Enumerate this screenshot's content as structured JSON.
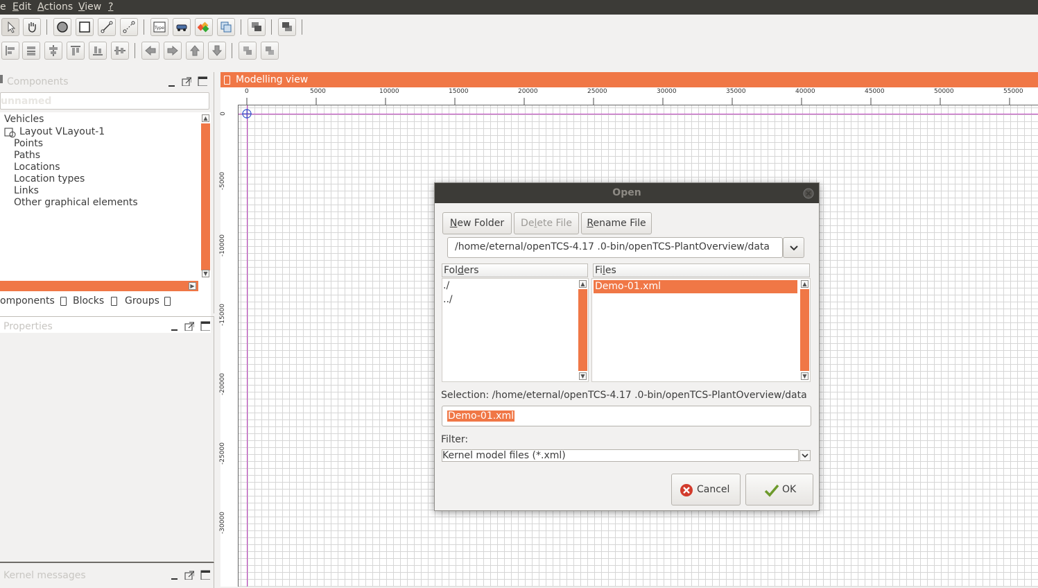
{
  "menubar": {
    "items": [
      "e",
      "Edit",
      "Actions",
      "View",
      "?"
    ]
  },
  "components_panel": {
    "title": "Components",
    "model_name": "unnamed",
    "tree": {
      "vehicles": "Vehicles",
      "layout": "Layout VLayout-1",
      "children": [
        "Points",
        "Paths",
        "Locations",
        "Location types",
        "Links",
        "Other graphical elements"
      ]
    },
    "tabs": [
      "omponents",
      "Blocks",
      "Groups"
    ]
  },
  "properties_panel": {
    "title": "Properties"
  },
  "kernel_panel": {
    "title": "Kernel messages"
  },
  "modelling_view": {
    "title": "Modelling view",
    "ruler_x": [
      "0",
      "5000",
      "10000",
      "15000",
      "20000",
      "25000",
      "30000",
      "35000",
      "40000",
      "45000",
      "50000",
      "55000"
    ],
    "ruler_y": [
      "0",
      "-5000",
      "-10000",
      "-15000",
      "-20000",
      "-25000",
      "-30000"
    ]
  },
  "dialog": {
    "title": "Open",
    "new_folder": "New Folder",
    "delete_file": "Delete File",
    "rename_file": "Rename File",
    "path": "/home/eternal/openTCS-4.17 .0-bin/openTCS-PlantOverview/data",
    "folders_header": "Folders",
    "files_header": "Files",
    "folders": [
      "./",
      "../"
    ],
    "files": [
      "Demo-01.xml"
    ],
    "selection_label": "Selection: /home/eternal/openTCS-4.17 .0-bin/openTCS-PlantOverview/data",
    "selection_value": "Demo-01.xml",
    "filter_label": "Filter:",
    "filter_value": "Kernel model files (*.xml)",
    "cancel": "Cancel",
    "ok": "OK"
  },
  "colors": {
    "accent": "#f07746",
    "menubar": "#3c3b37",
    "dialog_title": "#3c3b37"
  }
}
